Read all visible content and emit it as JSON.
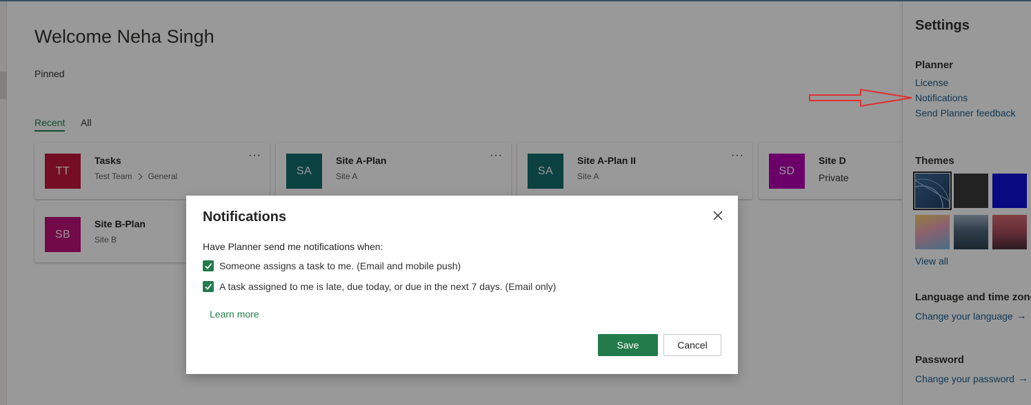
{
  "home": {
    "welcome": "Welcome Neha Singh",
    "pinned": "Pinned",
    "tabs": [
      "Recent",
      "All"
    ]
  },
  "cards": [
    {
      "initials": "TT",
      "title": "Tasks",
      "subtitle_parts": [
        "Test Team",
        "General"
      ],
      "color": "#c4183c"
    },
    {
      "initials": "SA",
      "title": "Site A-Plan",
      "subtitle": "Site A",
      "color": "#136d6d"
    },
    {
      "initials": "SA",
      "title": "Site A-Plan II",
      "subtitle": "Site A",
      "color": "#136d6d"
    },
    {
      "initials": "SD",
      "title": "Site D",
      "subtitle": "Private",
      "color": "#b200b2"
    },
    {
      "initials": "SB",
      "title": "Site B-Plan",
      "subtitle": "Site B",
      "color": "#bf0f78"
    }
  ],
  "card_more": "···",
  "settings": {
    "title": "Settings",
    "planner_heading": "Planner",
    "planner_links": [
      "License",
      "Notifications",
      "Send Planner feedback"
    ],
    "themes_heading": "Themes",
    "themes_view_all": "View all",
    "language_heading": "Language and time zone",
    "language_link": "Change your language",
    "password_heading": "Password",
    "password_link": "Change your password"
  },
  "dialog": {
    "title": "Notifications",
    "intro": "Have Planner send me notifications when:",
    "options": [
      {
        "label": "Someone assigns a task to me. (Email and mobile push)",
        "checked": true
      },
      {
        "label": "A task assigned to me is late, due today, or due in the next 7 days. (Email only)",
        "checked": true
      }
    ],
    "learn_more": "Learn more",
    "save": "Save",
    "cancel": "Cancel"
  },
  "colors": {
    "accent": "#237b4b",
    "link": "#1e5e8c",
    "annotation_arrow": "#e03030"
  }
}
